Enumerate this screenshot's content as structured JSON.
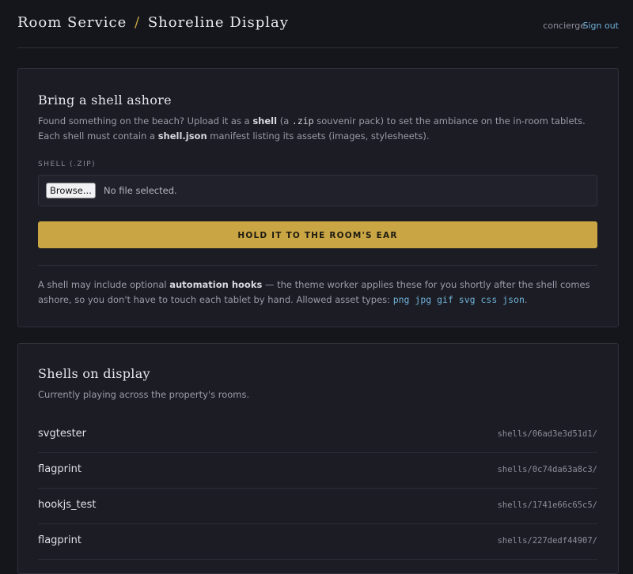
{
  "header": {
    "brand_primary": "Room Service",
    "brand_separator": "/",
    "brand_secondary": "Shoreline Display",
    "user": "concierge",
    "signout": "Sign out"
  },
  "upload": {
    "title": "Bring a shell ashore",
    "desc_1": "Found something on the beach? Upload it as a ",
    "desc_shell": "shell",
    "desc_2": " (a ",
    "desc_zip": ".zip",
    "desc_3": " souvenir pack) to set the ambiance on the in-room tablets. Each shell must contain a ",
    "desc_manifest": "shell.json",
    "desc_4": " manifest listing its assets (images, stylesheets).",
    "field_label": "SHELL (.ZIP)",
    "browse_label": "Browse...",
    "no_file": "No file selected.",
    "submit_label": "HOLD IT TO THE ROOM'S EAR",
    "note_1": "A shell may include optional ",
    "note_hooks": "automation hooks",
    "note_2": " — the theme worker applies these for you shortly after the shell comes ashore, so you don't have to touch each tablet by hand. Allowed asset types: ",
    "asset_types": "png jpg gif svg css json",
    "note_3": "."
  },
  "display": {
    "title": "Shells on display",
    "desc": "Currently playing across the property's rooms.",
    "shells": [
      {
        "name": "svgtester",
        "path": "shells/06ad3e3d51d1/"
      },
      {
        "name": "flagprint",
        "path": "shells/0c74da63a8c3/"
      },
      {
        "name": "hookjs_test",
        "path": "shells/1741e66c65c5/"
      },
      {
        "name": "flagprint",
        "path": "shells/227dedf44907/"
      }
    ]
  },
  "colors": {
    "background": "#15151c",
    "card": "#1b1c24",
    "accent": "#c9a544",
    "link": "#6fb2d8"
  }
}
